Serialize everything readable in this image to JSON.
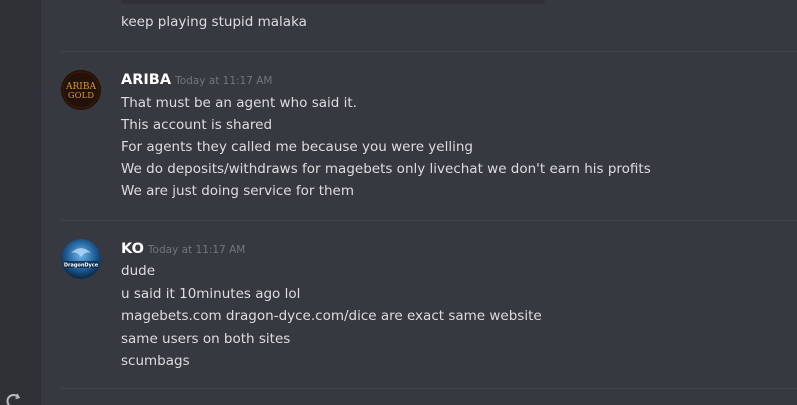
{
  "header_tail": {
    "text": "keep playing stupid malaka"
  },
  "messages": [
    {
      "username": "ARIBA",
      "timestamp": "Today at 11:17 AM",
      "avatar_text_1": "ARIBA",
      "avatar_text_2": "GOLD",
      "lines": [
        "That must be an agent who said it.",
        "This account is shared",
        "For agents they called me because you were yelling",
        "We do deposits/withdraws for magebets only livechat we don't earn his profits",
        "We are just doing service for them"
      ]
    },
    {
      "username": "KO",
      "timestamp": "Today at 11:17 AM",
      "avatar_text": "DragonDyce",
      "lines": [
        "dude",
        "u said it 10minutes ago lol",
        "magebets.com   dragon-dyce.com/dice are exact same website",
        "same users on both sites",
        "scumbags"
      ]
    }
  ],
  "colors": {
    "background": "#36393f",
    "text": "#dcddde",
    "username": "#ffffff",
    "timestamp": "#72767d",
    "divider": "#42454a"
  }
}
